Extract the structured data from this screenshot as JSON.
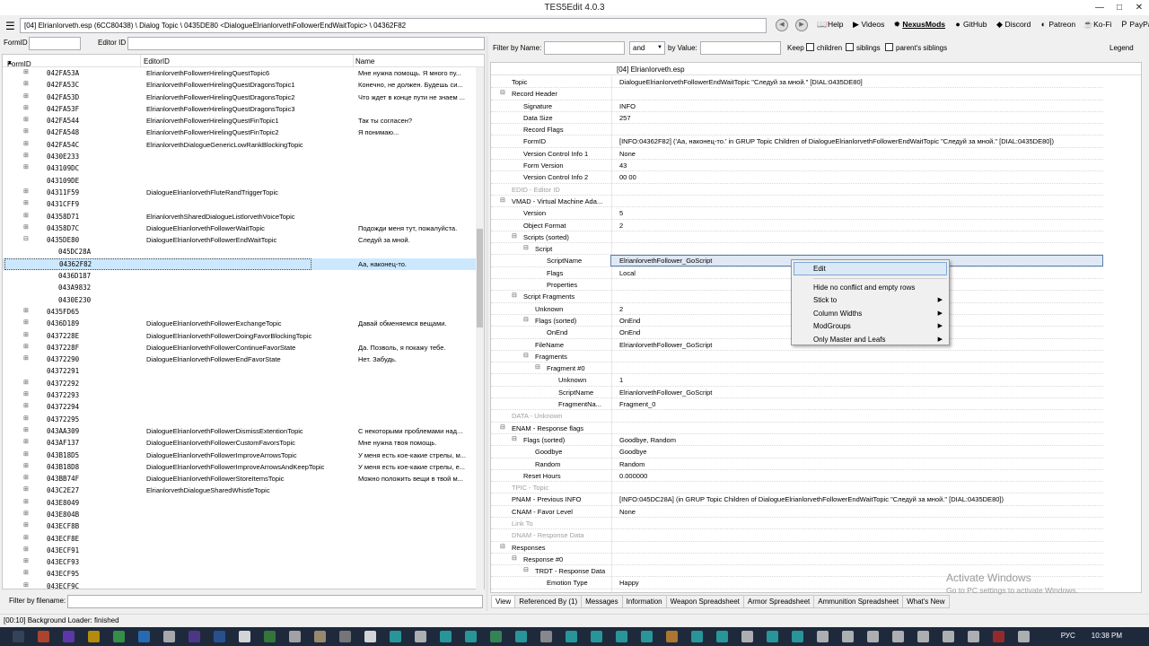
{
  "window": {
    "title": "TES5Edit 4.0.3",
    "controls": [
      "—",
      "□",
      "✕"
    ]
  },
  "toolbar": {
    "path": "[04] ElrianIorveth.esp (6CC80438) \\ Dialog Topic \\ 0435DE80 <DialogueElrianlorvethFollowerEndWaitTopic> \\ 04362F82",
    "links": [
      {
        "icon": "book-icon",
        "glyph": "📖",
        "label": "Help"
      },
      {
        "icon": "video-icon",
        "glyph": "▶",
        "label": "Videos"
      },
      {
        "icon": "nexusmods-icon",
        "glyph": "✹",
        "label": "NexusMods"
      },
      {
        "icon": "github-icon",
        "glyph": "●",
        "label": "GitHub"
      },
      {
        "icon": "discord-icon",
        "glyph": "◆",
        "label": "Discord"
      },
      {
        "icon": "patreon-icon",
        "glyph": "◐",
        "label": "Patreon"
      },
      {
        "icon": "kofi-icon",
        "glyph": "☕",
        "label": "Ko-Fi"
      },
      {
        "icon": "paypal-icon",
        "glyph": "P",
        "label": "PayPal"
      }
    ]
  },
  "id_filter": {
    "formid_label": "FormID",
    "editorid_label": "Editor ID"
  },
  "left_tree": {
    "columns": [
      "FormID",
      "EditorID",
      "Name"
    ],
    "sort_indicator": "▲",
    "rows": [
      {
        "id": "042FA53A",
        "ed": "ElrianlorvethFollowerHirelingQuestTopic6",
        "nm": "Мне нужна помощь. Я много пу...",
        "exp": "⊞",
        "lvl": 1
      },
      {
        "id": "042FA53C",
        "ed": "ElrianlorvethFollowerHirelingQuestDragonsTopic1",
        "nm": "Конечно, не должен. Будешь си...",
        "exp": "⊞",
        "lvl": 1
      },
      {
        "id": "042FA53D",
        "ed": "ElrianlorvethFollowerHirelingQuestDragonsTopic2",
        "nm": "Что ждет в конце пути не знаем ...",
        "exp": "⊞",
        "lvl": 1
      },
      {
        "id": "042FA53F",
        "ed": "ElrianlorvethFollowerHirelingQuestDragonsTopic3",
        "nm": "",
        "exp": "⊞",
        "lvl": 1
      },
      {
        "id": "042FA544",
        "ed": "ElrianlorvethFollowerHirelingQuestFinTopic1",
        "nm": "Так ты согласен?",
        "exp": "⊞",
        "lvl": 1
      },
      {
        "id": "042FA548",
        "ed": "ElrianlorvethFollowerHirelingQuestFinTopic2",
        "nm": "Я понимаю...",
        "exp": "⊞",
        "lvl": 1
      },
      {
        "id": "042FA54C",
        "ed": "ElrianlorvethDialogueGenericLowRankBlockingTopic",
        "nm": "",
        "exp": "⊞",
        "lvl": 1
      },
      {
        "id": "0430E233",
        "ed": "",
        "nm": "",
        "exp": "⊞",
        "lvl": 1
      },
      {
        "id": "043109DC",
        "ed": "",
        "nm": "",
        "exp": "⊞",
        "lvl": 1
      },
      {
        "id": "043109DE",
        "ed": "",
        "nm": "",
        "exp": "",
        "lvl": 1
      },
      {
        "id": "04311F59",
        "ed": "DialogueElrianlorvethFluteRandTriggerTopic",
        "nm": "",
        "exp": "⊞",
        "lvl": 1
      },
      {
        "id": "0431CFF9",
        "ed": "",
        "nm": "",
        "exp": "⊞",
        "lvl": 1
      },
      {
        "id": "04358D71",
        "ed": "ElrianlorvethSharedDialogueListlorvethVoiceTopic",
        "nm": "",
        "exp": "⊞",
        "lvl": 1
      },
      {
        "id": "04358D7C",
        "ed": "DialogueElrianlorvethFollowerWaitTopic",
        "nm": "Подожди меня тут, пожалуйста.",
        "exp": "⊞",
        "lvl": 1
      },
      {
        "id": "0435DE80",
        "ed": "DialogueElrianlorvethFollowerEndWaitTopic",
        "nm": "Следуй за мной.",
        "exp": "⊟",
        "lvl": 1
      },
      {
        "id": "045DC28A",
        "ed": "",
        "nm": "",
        "exp": "",
        "lvl": 2
      },
      {
        "id": "04362F82",
        "ed": "",
        "nm": "Аа, наконец-то.",
        "exp": "",
        "lvl": 2,
        "sel": true
      },
      {
        "id": "0436D187",
        "ed": "",
        "nm": "",
        "exp": "",
        "lvl": 2
      },
      {
        "id": "043A9832",
        "ed": "",
        "nm": "",
        "exp": "",
        "lvl": 2
      },
      {
        "id": "0430E230",
        "ed": "",
        "nm": "",
        "exp": "",
        "lvl": 2
      },
      {
        "id": "0435FD65",
        "ed": "",
        "nm": "",
        "exp": "⊞",
        "lvl": 1
      },
      {
        "id": "0436D189",
        "ed": "DialogueElrianlorvethFollowerExchangeTopic",
        "nm": "Давай обменяемся вещами.",
        "exp": "⊞",
        "lvl": 1
      },
      {
        "id": "0437228E",
        "ed": "DialogueElrianlorvethFollowerDoingFavorBlockingTopic",
        "nm": "",
        "exp": "⊞",
        "lvl": 1
      },
      {
        "id": "0437228F",
        "ed": "DialogueElrianlorvethFollowerContinueFavorState",
        "nm": "Да. Позволь, я покажу тебе.",
        "exp": "⊞",
        "lvl": 1
      },
      {
        "id": "04372290",
        "ed": "DialogueElrianlorvethFollowerEndFavorState",
        "nm": "Нет. Забудь.",
        "exp": "⊞",
        "lvl": 1
      },
      {
        "id": "04372291",
        "ed": "",
        "nm": "",
        "exp": "",
        "lvl": 1
      },
      {
        "id": "04372292",
        "ed": "",
        "nm": "",
        "exp": "⊞",
        "lvl": 1
      },
      {
        "id": "04372293",
        "ed": "",
        "nm": "",
        "exp": "⊞",
        "lvl": 1
      },
      {
        "id": "04372294",
        "ed": "",
        "nm": "",
        "exp": "⊞",
        "lvl": 1
      },
      {
        "id": "04372295",
        "ed": "",
        "nm": "",
        "exp": "⊞",
        "lvl": 1
      },
      {
        "id": "043AA309",
        "ed": "DialogueElrianlorvethFollowerDismissExtentionTopic",
        "nm": "С некоторыми проблемами над...",
        "exp": "⊞",
        "lvl": 1
      },
      {
        "id": "043AF137",
        "ed": "DialogueElrianlorvethFollowerCustomFavorsTopic",
        "nm": "Мне нужна твоя помощь.",
        "exp": "⊞",
        "lvl": 1
      },
      {
        "id": "043B18D5",
        "ed": "DialogueElrianlorvethFollowerImproveArrowsTopic",
        "nm": "У меня есть кое-какие стрелы, м...",
        "exp": "⊞",
        "lvl": 1
      },
      {
        "id": "043B18D8",
        "ed": "DialogueElrianlorvethFollowerImproveArrowsAndKeepTopic",
        "nm": "У меня есть кое-какие стрелы, е...",
        "exp": "⊞",
        "lvl": 1
      },
      {
        "id": "043BB74F",
        "ed": "DialogueElrianlorvethFollowerStoreItemsTopic",
        "nm": "Можно положить вещи в твой м...",
        "exp": "⊞",
        "lvl": 1
      },
      {
        "id": "043C2E27",
        "ed": "ElrianlorvethDialogueSharedWhistleTopic",
        "nm": "",
        "exp": "⊞",
        "lvl": 1
      },
      {
        "id": "043E8049",
        "ed": "",
        "nm": "",
        "exp": "⊞",
        "lvl": 1
      },
      {
        "id": "043E804B",
        "ed": "",
        "nm": "",
        "exp": "⊞",
        "lvl": 1
      },
      {
        "id": "043ECF8B",
        "ed": "",
        "nm": "",
        "exp": "⊞",
        "lvl": 1
      },
      {
        "id": "043ECF8E",
        "ed": "",
        "nm": "",
        "exp": "⊞",
        "lvl": 1
      },
      {
        "id": "043ECF91",
        "ed": "",
        "nm": "",
        "exp": "⊞",
        "lvl": 1
      },
      {
        "id": "043ECF93",
        "ed": "",
        "nm": "",
        "exp": "⊞",
        "lvl": 1
      },
      {
        "id": "043ECF95",
        "ed": "",
        "nm": "",
        "exp": "⊞",
        "lvl": 1
      },
      {
        "id": "043ECF9C",
        "ed": "",
        "nm": "",
        "exp": "⊞",
        "lvl": 1
      }
    ]
  },
  "filename_filter": {
    "label": "Filter by filename:"
  },
  "record_filter": {
    "by_name": "Filter by Name:",
    "op": "and",
    "by_value": "by Value:",
    "keep": "Keep",
    "children": "children",
    "siblings": "siblings",
    "parents_siblings": "parent's siblings",
    "legend": "Legend"
  },
  "record_view": {
    "header": "[04] ElrianIorveth.esp",
    "rows": [
      {
        "k": "Topic",
        "v": "DialogueElrianlorvethFollowerEndWaitTopic \"Следуй за мной.\" [DIAL:0435DE80]",
        "lvl": 0,
        "tg": ""
      },
      {
        "k": "Record Header",
        "v": "",
        "lvl": 0,
        "tg": "⊟"
      },
      {
        "k": "Signature",
        "v": "INFO",
        "lvl": 1,
        "tg": ""
      },
      {
        "k": "Data Size",
        "v": "257",
        "lvl": 1,
        "tg": ""
      },
      {
        "k": "Record Flags",
        "v": "",
        "lvl": 1,
        "tg": ""
      },
      {
        "k": "FormID",
        "v": "[INFO:04362F82] ('Аа, наконец-то.' in GRUP Topic Children of DialogueElrianlorvethFollowerEndWaitTopic \"Следуй за мной.\" [DIAL:0435DE80])",
        "lvl": 1,
        "tg": ""
      },
      {
        "k": "Version Control Info 1",
        "v": "None",
        "lvl": 1,
        "tg": ""
      },
      {
        "k": "Form Version",
        "v": "43",
        "lvl": 1,
        "tg": ""
      },
      {
        "k": "Version Control Info 2",
        "v": "00 00",
        "lvl": 1,
        "tg": ""
      },
      {
        "k": "EDID - Editor ID",
        "v": "",
        "lvl": 0,
        "tg": "",
        "grey": true
      },
      {
        "k": "VMAD - Virtual Machine Ada...",
        "v": "",
        "lvl": 0,
        "tg": "⊟"
      },
      {
        "k": "Version",
        "v": "5",
        "lvl": 1,
        "tg": ""
      },
      {
        "k": "Object Format",
        "v": "2",
        "lvl": 1,
        "tg": ""
      },
      {
        "k": "Scripts (sorted)",
        "v": "",
        "lvl": 1,
        "tg": "⊟"
      },
      {
        "k": "Script",
        "v": "",
        "lvl": 2,
        "tg": "⊟"
      },
      {
        "k": "ScriptName",
        "v": "ElrianlorvethFollower_GoScript",
        "lvl": 3,
        "tg": "",
        "hl": true
      },
      {
        "k": "Flags",
        "v": "Local",
        "lvl": 3,
        "tg": ""
      },
      {
        "k": "Properties",
        "v": "",
        "lvl": 3,
        "tg": ""
      },
      {
        "k": "Script Fragments",
        "v": "",
        "lvl": 1,
        "tg": "⊟"
      },
      {
        "k": "Unknown",
        "v": "2",
        "lvl": 2,
        "tg": ""
      },
      {
        "k": "Flags (sorted)",
        "v": "OnEnd",
        "lvl": 2,
        "tg": "⊟"
      },
      {
        "k": "OnEnd",
        "v": "OnEnd",
        "lvl": 3,
        "tg": ""
      },
      {
        "k": "FileName",
        "v": "ElrianlorvethFollower_GoScript",
        "lvl": 2,
        "tg": ""
      },
      {
        "k": "Fragments",
        "v": "",
        "lvl": 2,
        "tg": "⊟"
      },
      {
        "k": "Fragment #0",
        "v": "",
        "lvl": 3,
        "tg": "⊟"
      },
      {
        "k": "Unknown",
        "v": "1",
        "lvl": 4,
        "tg": ""
      },
      {
        "k": "ScriptName",
        "v": "ElrianlorvethFollower_GoScript",
        "lvl": 4,
        "tg": ""
      },
      {
        "k": "FragmentNa...",
        "v": "Fragment_0",
        "lvl": 4,
        "tg": ""
      },
      {
        "k": "DATA - Unknown",
        "v": "",
        "lvl": 0,
        "tg": "",
        "grey": true
      },
      {
        "k": "ENAM - Response flags",
        "v": "",
        "lvl": 0,
        "tg": "⊟"
      },
      {
        "k": "Flags (sorted)",
        "v": "Goodbye, Random",
        "lvl": 1,
        "tg": "⊟"
      },
      {
        "k": "Goodbye",
        "v": "Goodbye",
        "lvl": 2,
        "tg": ""
      },
      {
        "k": "Random",
        "v": "Random",
        "lvl": 2,
        "tg": ""
      },
      {
        "k": "Reset Hours",
        "v": "0.000000",
        "lvl": 1,
        "tg": ""
      },
      {
        "k": "TPIC - Topic",
        "v": "",
        "lvl": 0,
        "tg": "",
        "grey": true
      },
      {
        "k": "PNAM - Previous INFO",
        "v": "[INFO:045DC28A] (in GRUP Topic Children of DialogueElrianlorvethFollowerEndWaitTopic \"Следуй за мной.\" [DIAL:0435DE80])",
        "lvl": 0,
        "tg": ""
      },
      {
        "k": "CNAM - Favor Level",
        "v": "None",
        "lvl": 0,
        "tg": ""
      },
      {
        "k": "Link To",
        "v": "",
        "lvl": 0,
        "tg": "",
        "grey": true
      },
      {
        "k": "DNAM - Response Data",
        "v": "",
        "lvl": 0,
        "tg": "",
        "grey": true
      },
      {
        "k": "Responses",
        "v": "",
        "lvl": 0,
        "tg": "⊟"
      },
      {
        "k": "Response #0",
        "v": "",
        "lvl": 1,
        "tg": "⊟"
      },
      {
        "k": "TRDT - Response Data",
        "v": "",
        "lvl": 2,
        "tg": "⊟"
      },
      {
        "k": "Emotion Type",
        "v": "Happy",
        "lvl": 3,
        "tg": ""
      }
    ]
  },
  "context_menu": {
    "items": [
      {
        "label": "Edit",
        "sub": false,
        "active": true
      },
      {
        "sep": true
      },
      {
        "label": "Hide no conflict and empty rows",
        "sub": false
      },
      {
        "label": "Stick to",
        "sub": true
      },
      {
        "label": "Column Widths",
        "sub": true
      },
      {
        "label": "ModGroups",
        "sub": true
      },
      {
        "label": "Only Master and Leafs",
        "sub": true
      }
    ]
  },
  "bottom_tabs": [
    "View",
    "Referenced By (1)",
    "Messages",
    "Information",
    "Weapon Spreadsheet",
    "Armor Spreadsheet",
    "Ammunition Spreadsheet",
    "What's New"
  ],
  "status": "[00:10] Background Loader: finished",
  "watermark": {
    "line1": "Activate Windows",
    "line2": "Go to PC settings to activate Windows."
  },
  "taskbar": {
    "lang": "РУС",
    "time": "10:38 PM"
  }
}
